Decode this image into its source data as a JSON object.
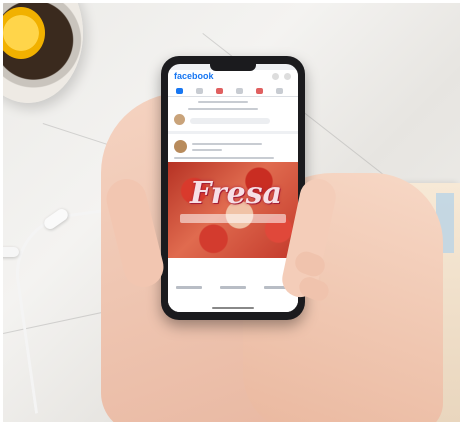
{
  "scene": {
    "description_items": [
      "marble-table",
      "tea-cup-with-lemon",
      "white-earbuds",
      "hands-holding-phone"
    ]
  },
  "phone_screen": {
    "app_title": "facebook",
    "post": {
      "image_title": "Fresa"
    }
  },
  "colors": {
    "brand": "#1877f2",
    "post_accent": "#d33b2e"
  }
}
